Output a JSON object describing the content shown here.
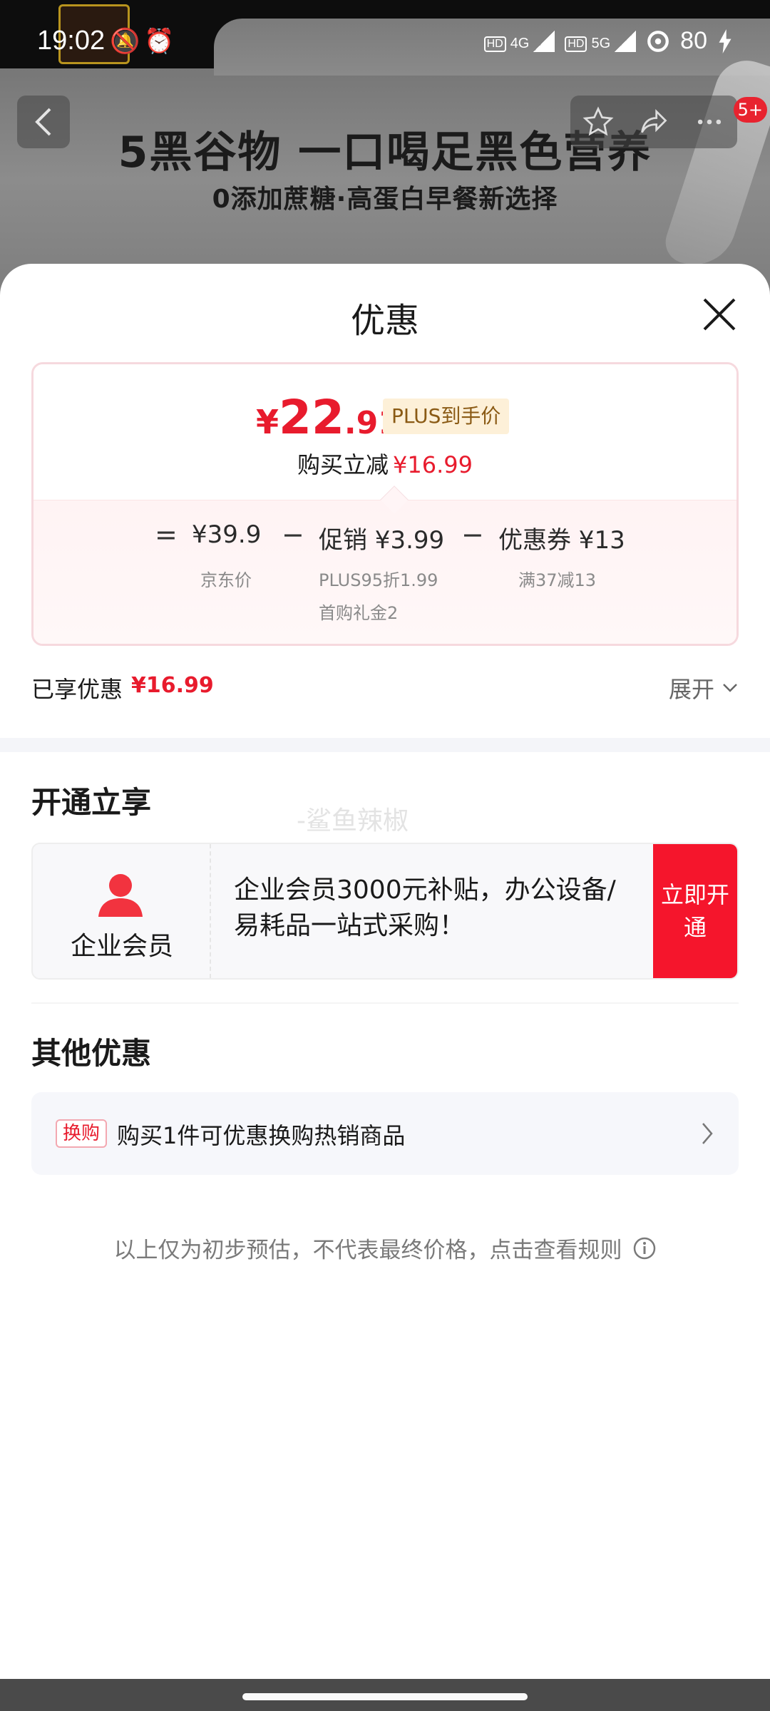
{
  "status_bar": {
    "time": "19:02",
    "left_icons": "🔕⏰",
    "net1": "4G",
    "net2": "5G",
    "battery": "80"
  },
  "background_page": {
    "banner_title": "5黑谷物 一口喝足黑色营养",
    "banner_subtitle": "0添加蔗糖·高蛋白早餐新选择",
    "badge": "5+"
  },
  "sheet": {
    "title": "优惠",
    "final_price": {
      "yen": "¥",
      "integer": "22",
      "decimal": ".91"
    },
    "plus_tag": "PLUS到手价",
    "instant_cut_label": "购买立减",
    "instant_cut_value": "¥16.99",
    "breakdown": {
      "equals": "=",
      "jd_price": "¥39.9",
      "jd_price_label": "京东价",
      "minus1": "−",
      "promo": "促销 ¥3.99",
      "promo_detail_1": "PLUS95折1.99",
      "promo_detail_2": "首购礼金2",
      "minus2": "−",
      "coupon": "优惠券 ¥13",
      "coupon_detail": "满37减13"
    },
    "enjoyed_label": "已享优惠",
    "enjoyed_value": "¥16.99",
    "expand_label": "展开",
    "open_section_title": "开通立享",
    "watermark": "-鲨鱼辣椒",
    "member_card": {
      "name": "企业会员",
      "description": "企业会员3000元补贴，办公设备/易耗品一站式采购！",
      "button": "立即开通"
    },
    "other_section_title": "其他优惠",
    "swap_offer": {
      "tag": "换购",
      "text": "购买1件可优惠换购热销商品"
    },
    "disclaimer": "以上仅为初步预估，不代表最终价格，点击查看规则"
  },
  "colors": {
    "accent_red": "#e81b2d",
    "button_red": "#f5152c",
    "plus_tag_bg": "#fdf0d8"
  }
}
